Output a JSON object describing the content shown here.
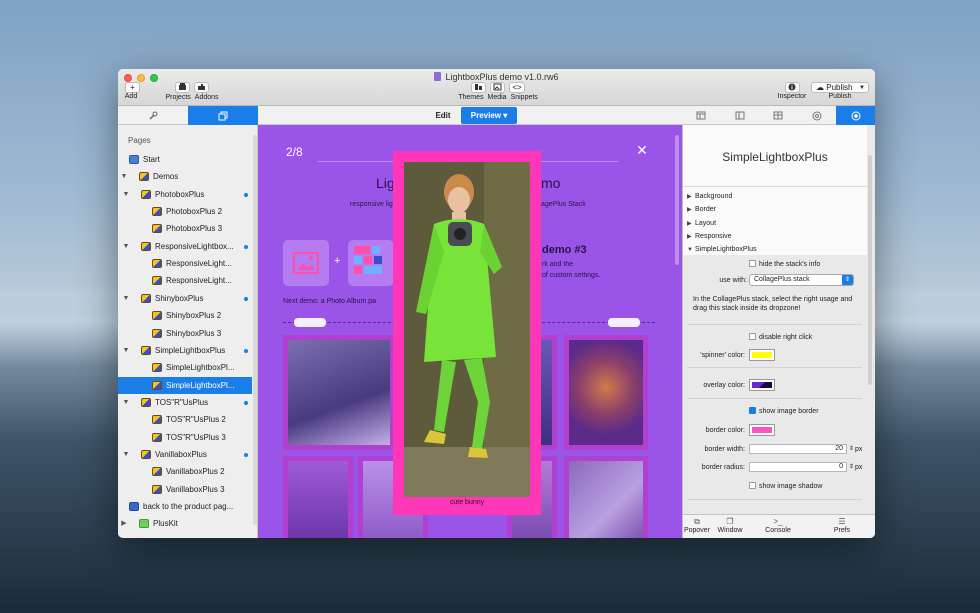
{
  "window": {
    "title": "LightboxPlus demo v1.0.rw6"
  },
  "toolbar": {
    "add": "Add",
    "projects": "Projects",
    "addons": "Addons",
    "themes": "Themes",
    "media": "Media",
    "snippets": "Snippets",
    "inspector": "Inspector",
    "publish_btn": "Publish",
    "publish": "Publish",
    "add_glyph": "+",
    "snippets_glyph": "<>"
  },
  "tabs": {
    "edit": "Edit",
    "preview": "Preview ▾"
  },
  "sidebar": {
    "header": "Pages",
    "items": [
      {
        "label": "Start",
        "level": 0
      },
      {
        "label": "Demos",
        "level": 0,
        "tri": "▼"
      },
      {
        "label": "PhotoboxPlus",
        "level": 1,
        "tri": "▼",
        "dot": true
      },
      {
        "label": "PhotoboxPlus 2",
        "level": 2
      },
      {
        "label": "PhotoboxPlus 3",
        "level": 2
      },
      {
        "label": "ResponsiveLightbox...",
        "level": 1,
        "tri": "▼",
        "dot": true
      },
      {
        "label": "ResponsiveLight...",
        "level": 2
      },
      {
        "label": "ResponsiveLight...",
        "level": 2
      },
      {
        "label": "ShinyboxPlus",
        "level": 1,
        "tri": "▼",
        "dot": true
      },
      {
        "label": "ShinyboxPlus 2",
        "level": 2
      },
      {
        "label": "ShinyboxPlus 3",
        "level": 2
      },
      {
        "label": "SimpleLightboxPlus",
        "level": 1,
        "tri": "▼",
        "dot": true
      },
      {
        "label": "SimpleLightboxPl...",
        "level": 2
      },
      {
        "label": "SimpleLightboxPl...",
        "level": 2,
        "selected": true
      },
      {
        "label": "TOS\"R\"UsPlus",
        "level": 1,
        "tri": "▼",
        "dot": true
      },
      {
        "label": "TOS\"R\"UsPlus 2",
        "level": 2
      },
      {
        "label": "TOS\"R\"UsPlus 3",
        "level": 2
      },
      {
        "label": "VanillaboxPlus",
        "level": 1,
        "tri": "▼",
        "dot": true
      },
      {
        "label": "VanillaboxPlus 2",
        "level": 2
      },
      {
        "label": "VanillaboxPlus 3",
        "level": 2
      },
      {
        "label": "back to the product pag...",
        "level": 0
      },
      {
        "label": "PlusKit",
        "level": 0,
        "tri": "▶"
      }
    ]
  },
  "preview": {
    "counter": "2/8",
    "close": "✕",
    "heading_left": "Lig",
    "heading_right": "mo",
    "sub_left": "responsive lig",
    "sub_right": "agePlus Stack",
    "demo3": "demo #3",
    "demo3_text1": "rk and the",
    "demo3_text2": "of custom settings.",
    "plus": "+",
    "next_demo": "Next demo: a Photo Album pa",
    "caption": "cute bunny"
  },
  "inspector": {
    "title": "SimpleLightboxPlus",
    "sections": [
      "Background",
      "Border",
      "Layout",
      "Responsive",
      "SimpleLightboxPlus"
    ],
    "section_tris": [
      "▶",
      "▶",
      "▶",
      "▶",
      "▼"
    ],
    "hide_info": "hide the stack's info",
    "use_with_label": "use with:",
    "use_with_value": "CollagePlus stack",
    "help": "In the CollagePlus stack, select the right usage and drag this stack inside its dropzone!",
    "disable_right_click": "disable right click",
    "spinner_label": "'spinner' color:",
    "overlay_label": "overlay color:",
    "show_border": "show image border",
    "border_color_label": "border color:",
    "border_width_label": "border width:",
    "border_width": "20",
    "border_radius_label": "border radius:",
    "border_radius": "0",
    "px": "px",
    "show_shadow": "show image shadow",
    "bottom": [
      "Popover",
      "Window",
      "Console",
      "Prefs"
    ]
  },
  "colors": {
    "accent": "#1b7ee8",
    "spinner": "#ffff00",
    "border": "#ff52c0",
    "overlay": "#6a2ad0",
    "lightbox_border": "#ff36b8",
    "preview_bg": "#9a55e8"
  }
}
